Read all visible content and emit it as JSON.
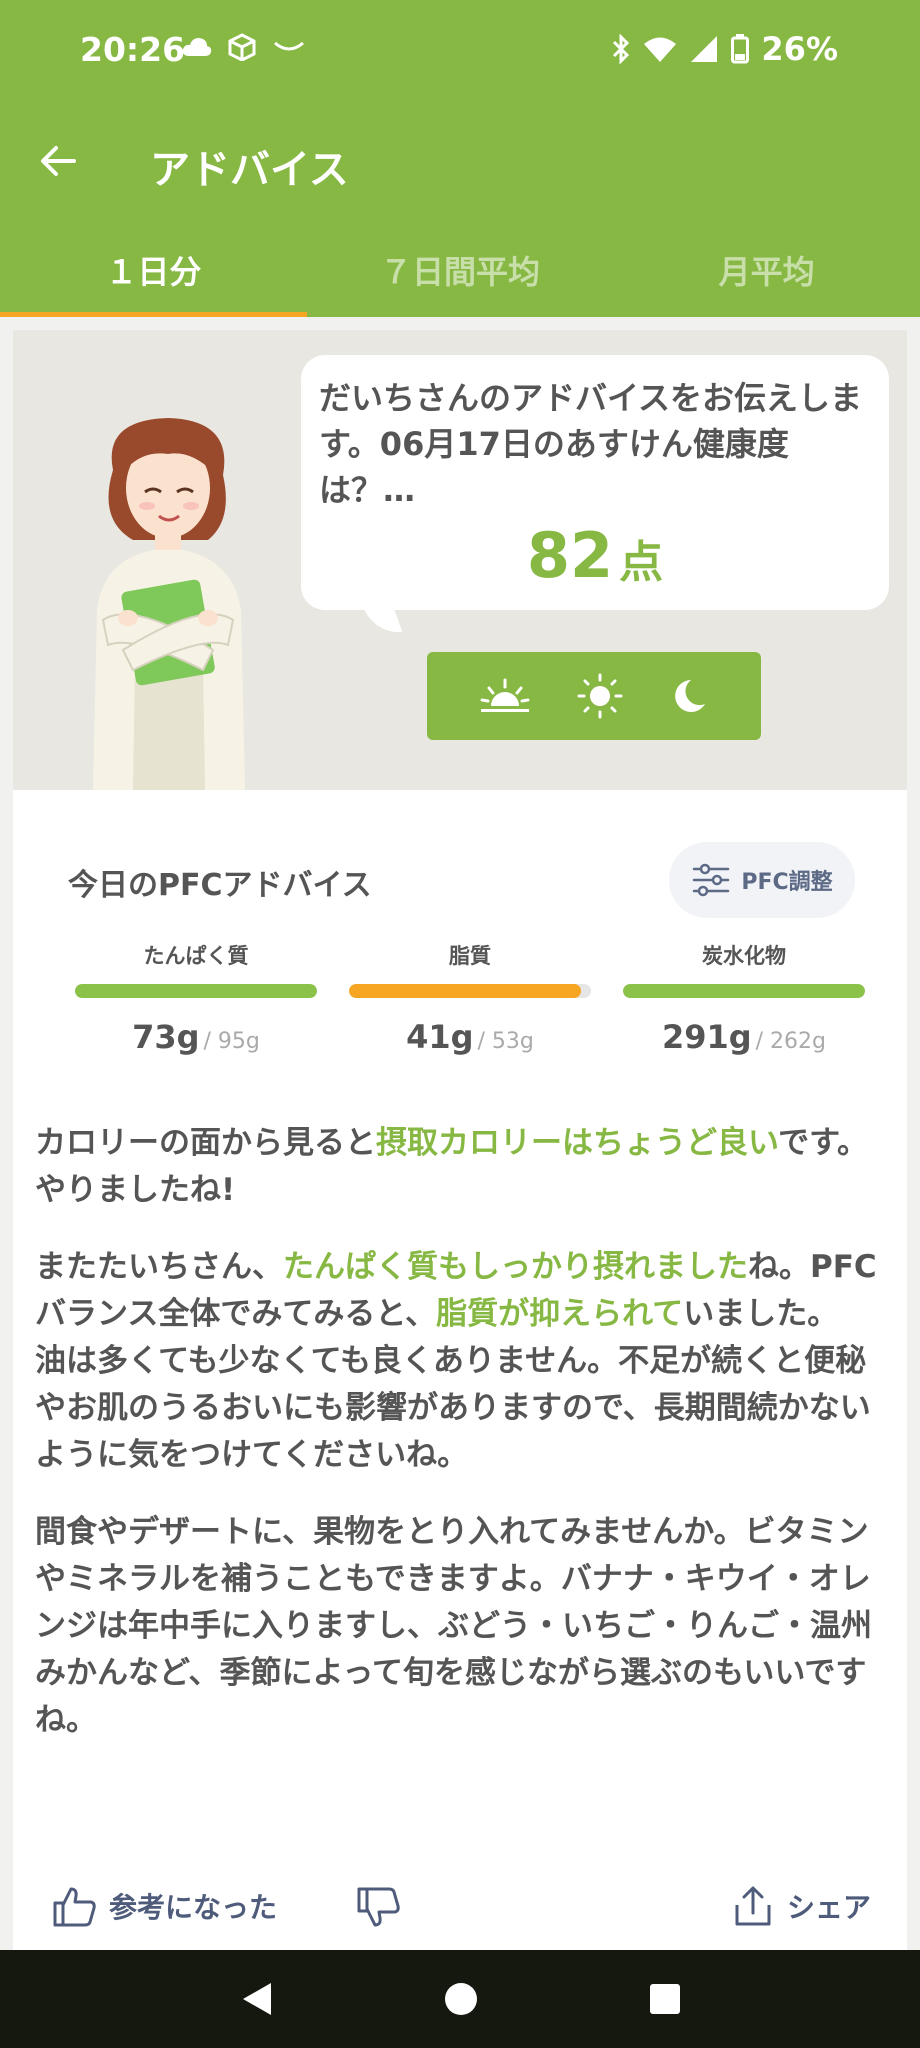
{
  "status_bar": {
    "time": "20:26",
    "battery": "26%",
    "left_icons": [
      "cloud-icon",
      "package-icon",
      "smile-icon"
    ],
    "right_icons": [
      "bluetooth-icon",
      "wifi-icon",
      "signal-icon",
      "battery-icon"
    ]
  },
  "app_bar": {
    "title": "アドバイス"
  },
  "tabs": [
    {
      "label": "１日分",
      "active": true
    },
    {
      "label": "７日間平均",
      "active": false
    },
    {
      "label": "月平均",
      "active": false
    }
  ],
  "hero": {
    "message": "だいちさんのアドバイスをお伝えします。06月17日のあすけん健康度は？…",
    "score": "82",
    "score_unit": "点",
    "time_buttons": [
      "sunrise-icon",
      "sun-icon",
      "moon-icon"
    ]
  },
  "pfc": {
    "title": "今日のPFCアドバイス",
    "adjust_label": "PFC調整",
    "nutrients": [
      {
        "label": "たんぱく質",
        "value": "73",
        "unit": "g",
        "target": "/ 95g",
        "fill": 1.0,
        "color": "#8bc34a"
      },
      {
        "label": "脂質",
        "value": "41",
        "unit": "g",
        "target": "/ 53g",
        "fill": 0.96,
        "color": "#f6a623"
      },
      {
        "label": "炭水化物",
        "value": "291",
        "unit": "g",
        "target": "/ 262g",
        "fill": 1.0,
        "color": "#8bc34a"
      }
    ]
  },
  "advice": {
    "p1": {
      "a": "カロリーの面から見ると",
      "hl": "摂取カロリーはちょうど良い",
      "b": "です。やりましたね!"
    },
    "p2": {
      "a": "またたいちさん、",
      "hl1": "たんぱく質もしっかり摂れました",
      "b": "ね。PFCバランス全体でみてみると、",
      "hl2": "脂質が抑えられて",
      "c": "いました。",
      "d": "油は多くても少なくても良くありません。不足が続くと便秘やお肌のうるおいにも影響がありますので、長期間続かないように気をつけてくださいね。"
    },
    "p3": "間食やデザートに、果物をとり入れてみませんか。ビタミンやミネラルを補うこともできますよ。バナナ・キウイ・オレンジは年中手に入りますし、ぶどう・いちご・りんご・温州みかんなど、季節によって旬を感じながら選ぶのもいいですね。"
  },
  "feedback": {
    "helpful_label": "参考になった",
    "share_label": "シェア"
  },
  "colors": {
    "brand_green": "#87b843",
    "accent_orange": "#f6a623"
  }
}
